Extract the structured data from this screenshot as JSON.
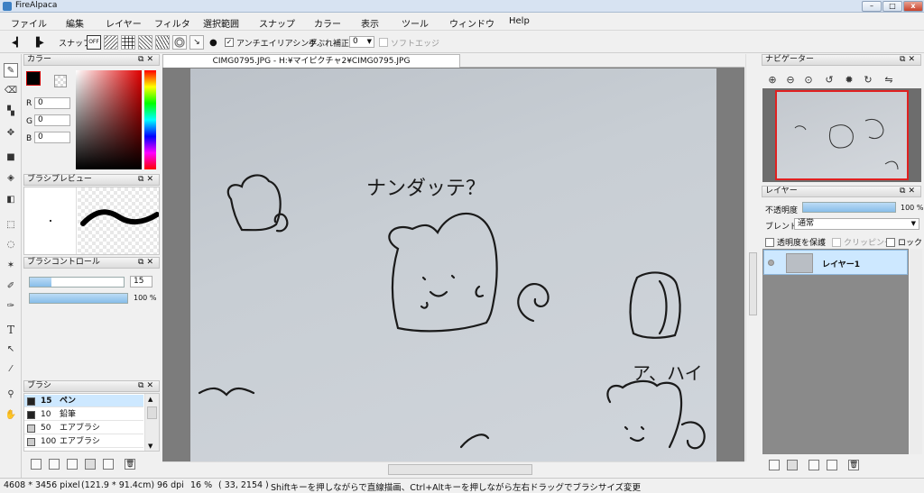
{
  "window": {
    "title": "FireAlpaca",
    "minimize": "–",
    "maximize": "□",
    "close": "x"
  },
  "menu": [
    "ファイル",
    "編集",
    "レイヤー",
    "フィルタ",
    "選択範囲",
    "スナップ",
    "カラー",
    "表示",
    "ツール",
    "ウィンドウ",
    "Help"
  ],
  "toolbar": {
    "snap_label": "スナップ",
    "snap_off": "OFF",
    "antialias_label": "アンチエイリアシング",
    "antialias_checked": "✓",
    "stabilizer_label": "手ぶれ補正",
    "stabilizer_value": "0",
    "soft_edge_label": "ソフトエッジ"
  },
  "color_panel": {
    "title": "カラー",
    "r_label": "R",
    "g_label": "G",
    "b_label": "B",
    "r": "0",
    "g": "0",
    "b": "0",
    "foreground": "#000000",
    "accent": "#cc0000"
  },
  "brush_preview": {
    "title": "ブラシプレビュー"
  },
  "brush_control": {
    "title": "ブラシコントロール",
    "size": "15",
    "opacity": "100 %",
    "size_fraction": 0.23,
    "opacity_fraction": 1.0
  },
  "brush_list": {
    "title": "ブラシ",
    "items": [
      {
        "size": "15",
        "name": "ペン"
      },
      {
        "size": "10",
        "name": "鉛筆"
      },
      {
        "size": "50",
        "name": "エアブラシ"
      },
      {
        "size": "100",
        "name": "エアブラシ"
      }
    ]
  },
  "document": {
    "tab_title": "CIMG0795.JPG - H:¥マイピクチャ2¥CIMG0795.JPG"
  },
  "canvas_text": {
    "text1": "ナンダッテ？",
    "text2": "ア、ハイ"
  },
  "navigator": {
    "title": "ナビゲーター"
  },
  "layer_panel": {
    "title": "レイヤー",
    "opacity_label": "不透明度",
    "opacity_value": "100 %",
    "opacity_fraction": 1.0,
    "blend_label": "ブレンド",
    "blend_value": "通常",
    "protect_alpha": "透明度を保護",
    "clipping": "クリッピング",
    "lock": "ロック",
    "layer_name": "レイヤー1"
  },
  "statusbar": {
    "image_size": "4608 * 3456 pixel",
    "physical_size": "(121.9 * 91.4cm)",
    "dpi": "96 dpi",
    "zoom": "16 %",
    "coords": "( 33, 2154 )",
    "hint": "Shiftキーを押しながらで直線描画、Ctrl+Altキーを押しながら左右ドラッグでブラシサイズ変更"
  }
}
